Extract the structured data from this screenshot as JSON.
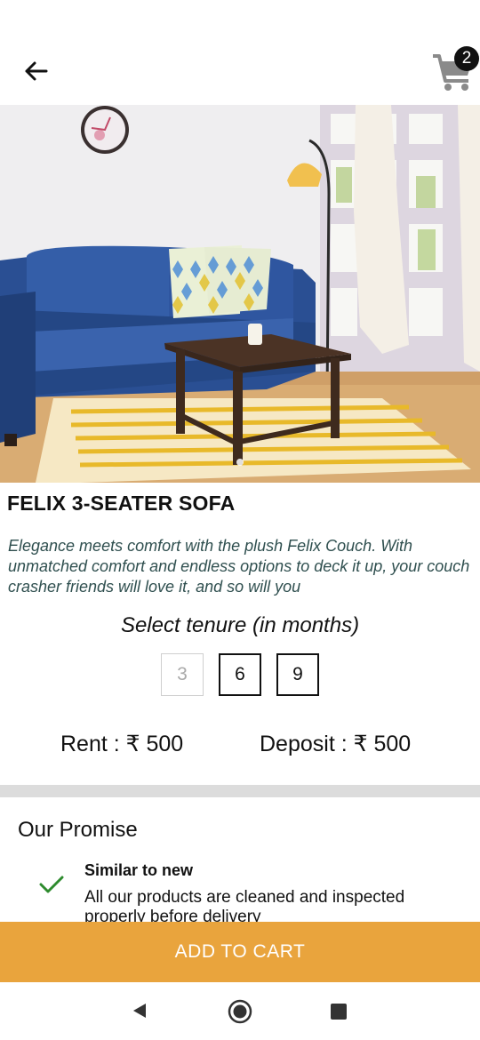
{
  "header": {
    "back_icon": "arrow-left-icon",
    "cart_icon": "shopping-cart-icon",
    "cart_count": "2"
  },
  "product": {
    "image_alt": "Blue three-seater sofa with patterned cushions, wooden coffee table and striped rug",
    "name": "FELIX 3-SEATER SOFA",
    "description": "Elegance meets comfort with the plush Felix Couch. With unmatched comfort and endless options to deck it up, your couch crasher friends will love it, and so will you"
  },
  "tenure": {
    "label": "Select tenure (in months)",
    "options": [
      {
        "value": "3",
        "enabled": false
      },
      {
        "value": "6",
        "enabled": true
      },
      {
        "value": "9",
        "enabled": true
      }
    ]
  },
  "pricing": {
    "rent": "Rent : ₹ 500",
    "deposit": "Deposit : ₹ 500"
  },
  "promise": {
    "title": "Our Promise",
    "items": [
      {
        "icon": "check-icon",
        "heading": "Similar to new",
        "text": "All our products are cleaned and inspected properly before delivery"
      }
    ]
  },
  "cta": {
    "add_to_cart": "ADD TO CART"
  },
  "colors": {
    "accent": "#e9a43d",
    "check": "#2e8b2e",
    "description": "#2f4f4f"
  }
}
